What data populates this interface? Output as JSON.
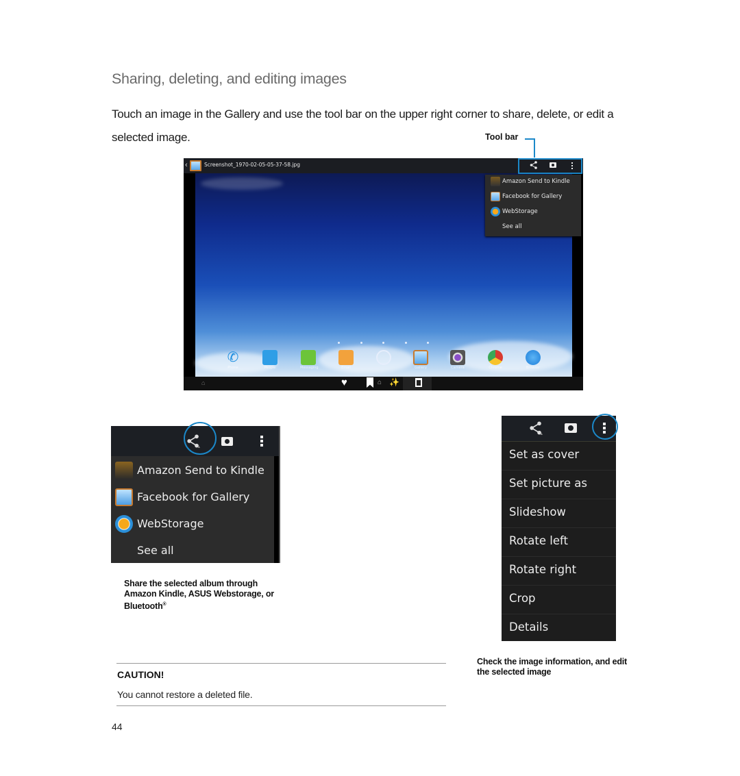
{
  "section": {
    "heading": "Sharing, deleting, and editing images",
    "intro": "Touch an image in the Gallery and use the tool bar on the upper right corner to share, delete, or edit a selected image.",
    "toolbar_callout": "Tool bar"
  },
  "screenshot": {
    "filename": "Screenshot_1970-02-05-05-37-58.jpg",
    "share_menu": [
      {
        "label": "Amazon Send to Kindle",
        "icon": "kindle-icon"
      },
      {
        "label": "Facebook for Gallery",
        "icon": "gallery-icon"
      },
      {
        "label": "WebStorage",
        "icon": "webstorage-icon"
      },
      {
        "label": "See all",
        "icon": ""
      }
    ],
    "page_indicator_count": 5,
    "dock": [
      {
        "label": "Phone",
        "icon": "phone-icon",
        "color": "#1e8fe0"
      },
      {
        "label": "People",
        "icon": "contacts-icon",
        "color": "#2f9ee6"
      },
      {
        "label": "Messaging",
        "icon": "messaging-icon",
        "color": "#6cc43a"
      },
      {
        "label": "Email",
        "icon": "email-icon",
        "color": "#f2a23c"
      },
      {
        "label": "",
        "icon": "apps-drawer-icon",
        "color": "#9fbde3"
      },
      {
        "label": "Gallery",
        "icon": "gallery-icon",
        "color": "#c77a2e"
      },
      {
        "label": "Camera",
        "icon": "camera-icon",
        "color": "#555555"
      },
      {
        "label": "Chrome",
        "icon": "chrome-icon",
        "color": "#d9392f"
      },
      {
        "label": "Browser",
        "icon": "browser-icon",
        "color": "#2a8de6"
      }
    ]
  },
  "share_inset": {
    "items": [
      {
        "label": "Amazon Send to Kindle",
        "icon": "kindle-icon"
      },
      {
        "label": "Facebook for Gallery",
        "icon": "gallery-icon"
      },
      {
        "label": "WebStorage",
        "icon": "webstorage-icon"
      },
      {
        "label": "See all",
        "icon": ""
      }
    ],
    "caption": "Share the selected album through Amazon Kindle, ASUS Webstorage, or Bluetooth",
    "caption_mark": "®"
  },
  "more_inset": {
    "items": [
      "Set as cover",
      "Set picture as",
      "Slideshow",
      "Rotate left",
      "Rotate right",
      "Crop",
      "Details"
    ],
    "caption": "Check the image information, and edit the selected image"
  },
  "caution": {
    "title": "CAUTION!",
    "text": "You cannot restore a deleted file."
  },
  "page_number": "44",
  "colors": {
    "accent_blue": "#1b88c9",
    "heading_gray": "#6a6a6a"
  }
}
